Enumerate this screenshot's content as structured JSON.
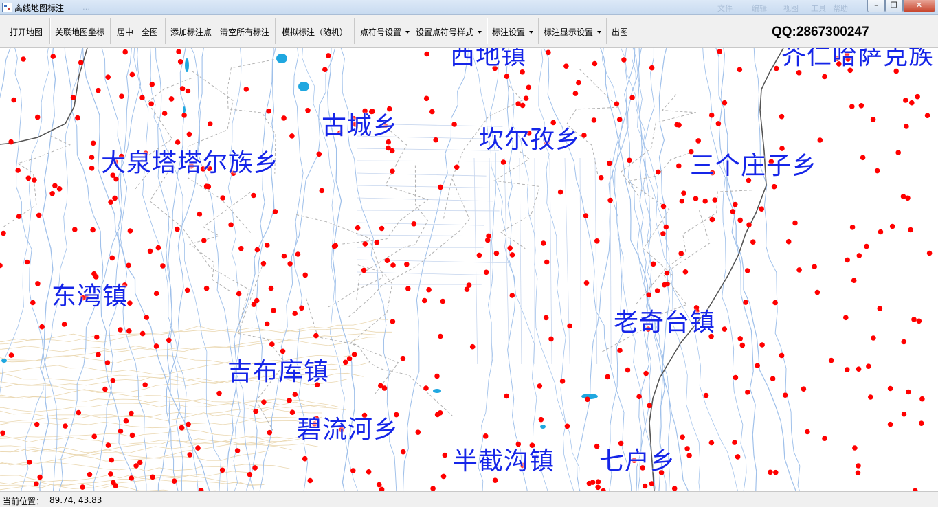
{
  "window": {
    "title": "离线地图标注",
    "ghost_title": "…",
    "ghost_menus": [
      "文件",
      "编辑",
      "视图",
      "工具",
      "帮助"
    ]
  },
  "toolbar": {
    "open_map": "打开地图",
    "link_coords": "关联地图坐标",
    "center": "居中",
    "full_extent": "全图",
    "add_point": "添加标注点",
    "clear_all": "清空所有标注",
    "simulate": "模拟标注（随机）",
    "symbol_settings": "点符号设置",
    "symbol_style": "设置点符号样式",
    "label_settings": "标注设置",
    "label_display": "标注显示设置",
    "export_map": "出图",
    "qq": "QQ:2867300247"
  },
  "map": {
    "places": [
      {
        "name": "西地镇"
      },
      {
        "name": "芥仁哈萨克族"
      },
      {
        "name": "古城乡"
      },
      {
        "name": "坎尔孜乡"
      },
      {
        "name": "大泉塔塔尔族乡"
      },
      {
        "name": "三个庄子乡"
      },
      {
        "name": "东湾镇"
      },
      {
        "name": "老奇台镇"
      },
      {
        "name": "吉布库镇"
      },
      {
        "name": "碧流河乡"
      },
      {
        "name": "半截沟镇"
      },
      {
        "name": "七户乡"
      }
    ],
    "colors": {
      "point": "#ff0000",
      "label": "#1525e8",
      "river": "#9fc0ea",
      "lake": "#1fa7e0",
      "road": "#b0b0b0",
      "border": "#555555",
      "contour": "#ead7b0"
    }
  },
  "status": {
    "label": "当前位置：",
    "value": "89.74, 43.83"
  }
}
